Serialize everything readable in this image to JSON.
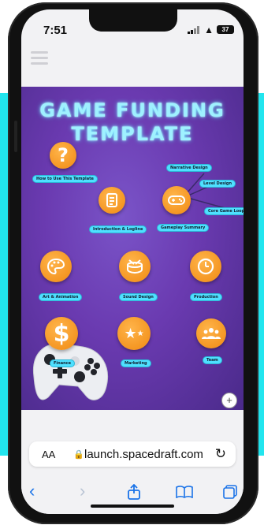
{
  "status": {
    "time": "7:51",
    "battery": "37"
  },
  "page": {
    "title_line1": "GAME FUNDING",
    "title_line2": "TEMPLATE",
    "nodes": [
      {
        "label": "How to Use This Template",
        "icon": "question-icon"
      },
      {
        "label": "Introduction & Logline",
        "icon": "document-icon"
      },
      {
        "label": "Gameplay Summary",
        "icon": "gamepad-icon"
      },
      {
        "label": "Narrative Design",
        "icon": ""
      },
      {
        "label": "Level Design",
        "icon": ""
      },
      {
        "label": "Core Game Loop",
        "icon": ""
      },
      {
        "label": "Art & Animation",
        "icon": "palette-icon"
      },
      {
        "label": "Sound Design",
        "icon": "drum-icon"
      },
      {
        "label": "Production",
        "icon": "clock-icon"
      },
      {
        "label": "Finance",
        "icon": "dollar-icon"
      },
      {
        "label": "Marketing",
        "icon": "stars-icon"
      },
      {
        "label": "Team",
        "icon": "team-icon"
      }
    ],
    "zoom_in": "+",
    "zoom_out": "−"
  },
  "browser": {
    "aa_label": "AA",
    "url": "launch.spacedraft.com",
    "reload_icon": "reload-icon",
    "nav_icons": [
      "back-icon",
      "forward-icon",
      "share-icon",
      "bookmarks-icon",
      "tabs-icon"
    ]
  },
  "colors": {
    "accent": "#4fe0ff",
    "node": "#f08a12",
    "background": "#6a3ab0",
    "frame": "#22e5ee"
  }
}
